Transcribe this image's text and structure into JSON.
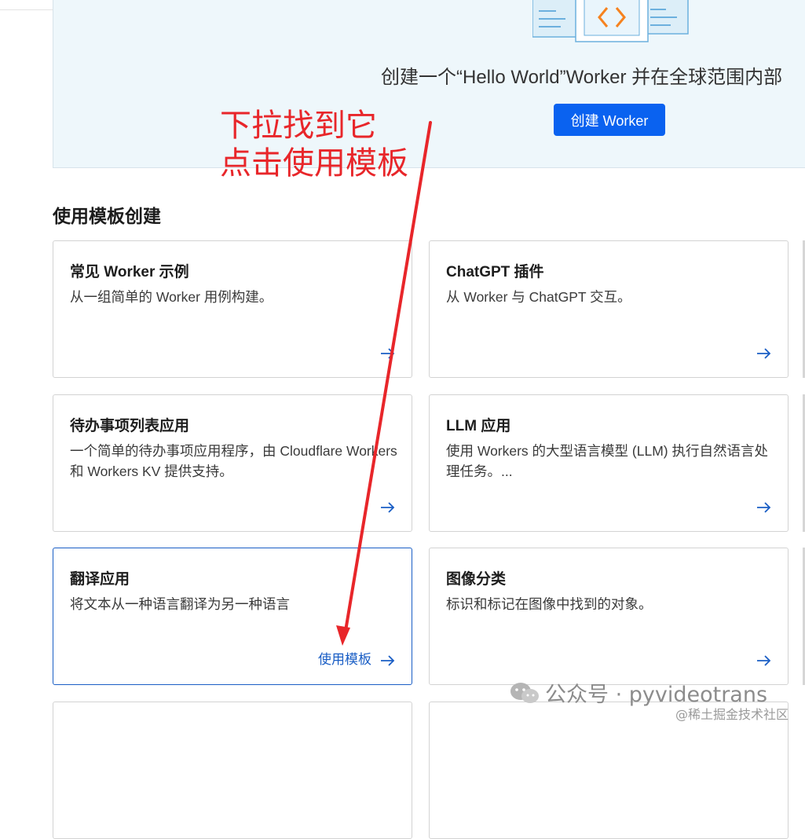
{
  "banner": {
    "text": "创建一个“Hello World”Worker 并在全球范围内部",
    "button_label": "创建 Worker",
    "illustration_icon": "code-window-icon"
  },
  "section": {
    "title": "使用模板创建"
  },
  "cards": [
    {
      "title": "常见 Worker 示例",
      "desc": "从一组简单的 Worker 用例构建。"
    },
    {
      "title": "ChatGPT 插件",
      "desc": "从 Worker 与 ChatGPT 交互。"
    },
    {
      "title": "待办事项列表应用",
      "desc": "一个简单的待办事项应用程序，由 Cloudflare Workers 和 Workers KV 提供支持。"
    },
    {
      "title": "LLM 应用",
      "desc": "使用 Workers 的大型语言模型 (LLM) 执行自然语言处理任务。..."
    },
    {
      "title": "翻译应用",
      "desc": "将文本从一种语言翻译为另一种语言",
      "action_label": "使用模板"
    },
    {
      "title": "图像分类",
      "desc": "标识和标记在图像中找到的对象。"
    }
  ],
  "annotation": {
    "line1": "下拉找到它",
    "line2": "点击使用模板",
    "color": "#e8262a"
  },
  "watermark": {
    "text": "公众号 · pyvideotrans",
    "sub": "@稀土掘金技术社区"
  },
  "colors": {
    "accent": "#0a62f0",
    "link": "#1a5ec5",
    "banner_bg": "#eef7fb"
  }
}
